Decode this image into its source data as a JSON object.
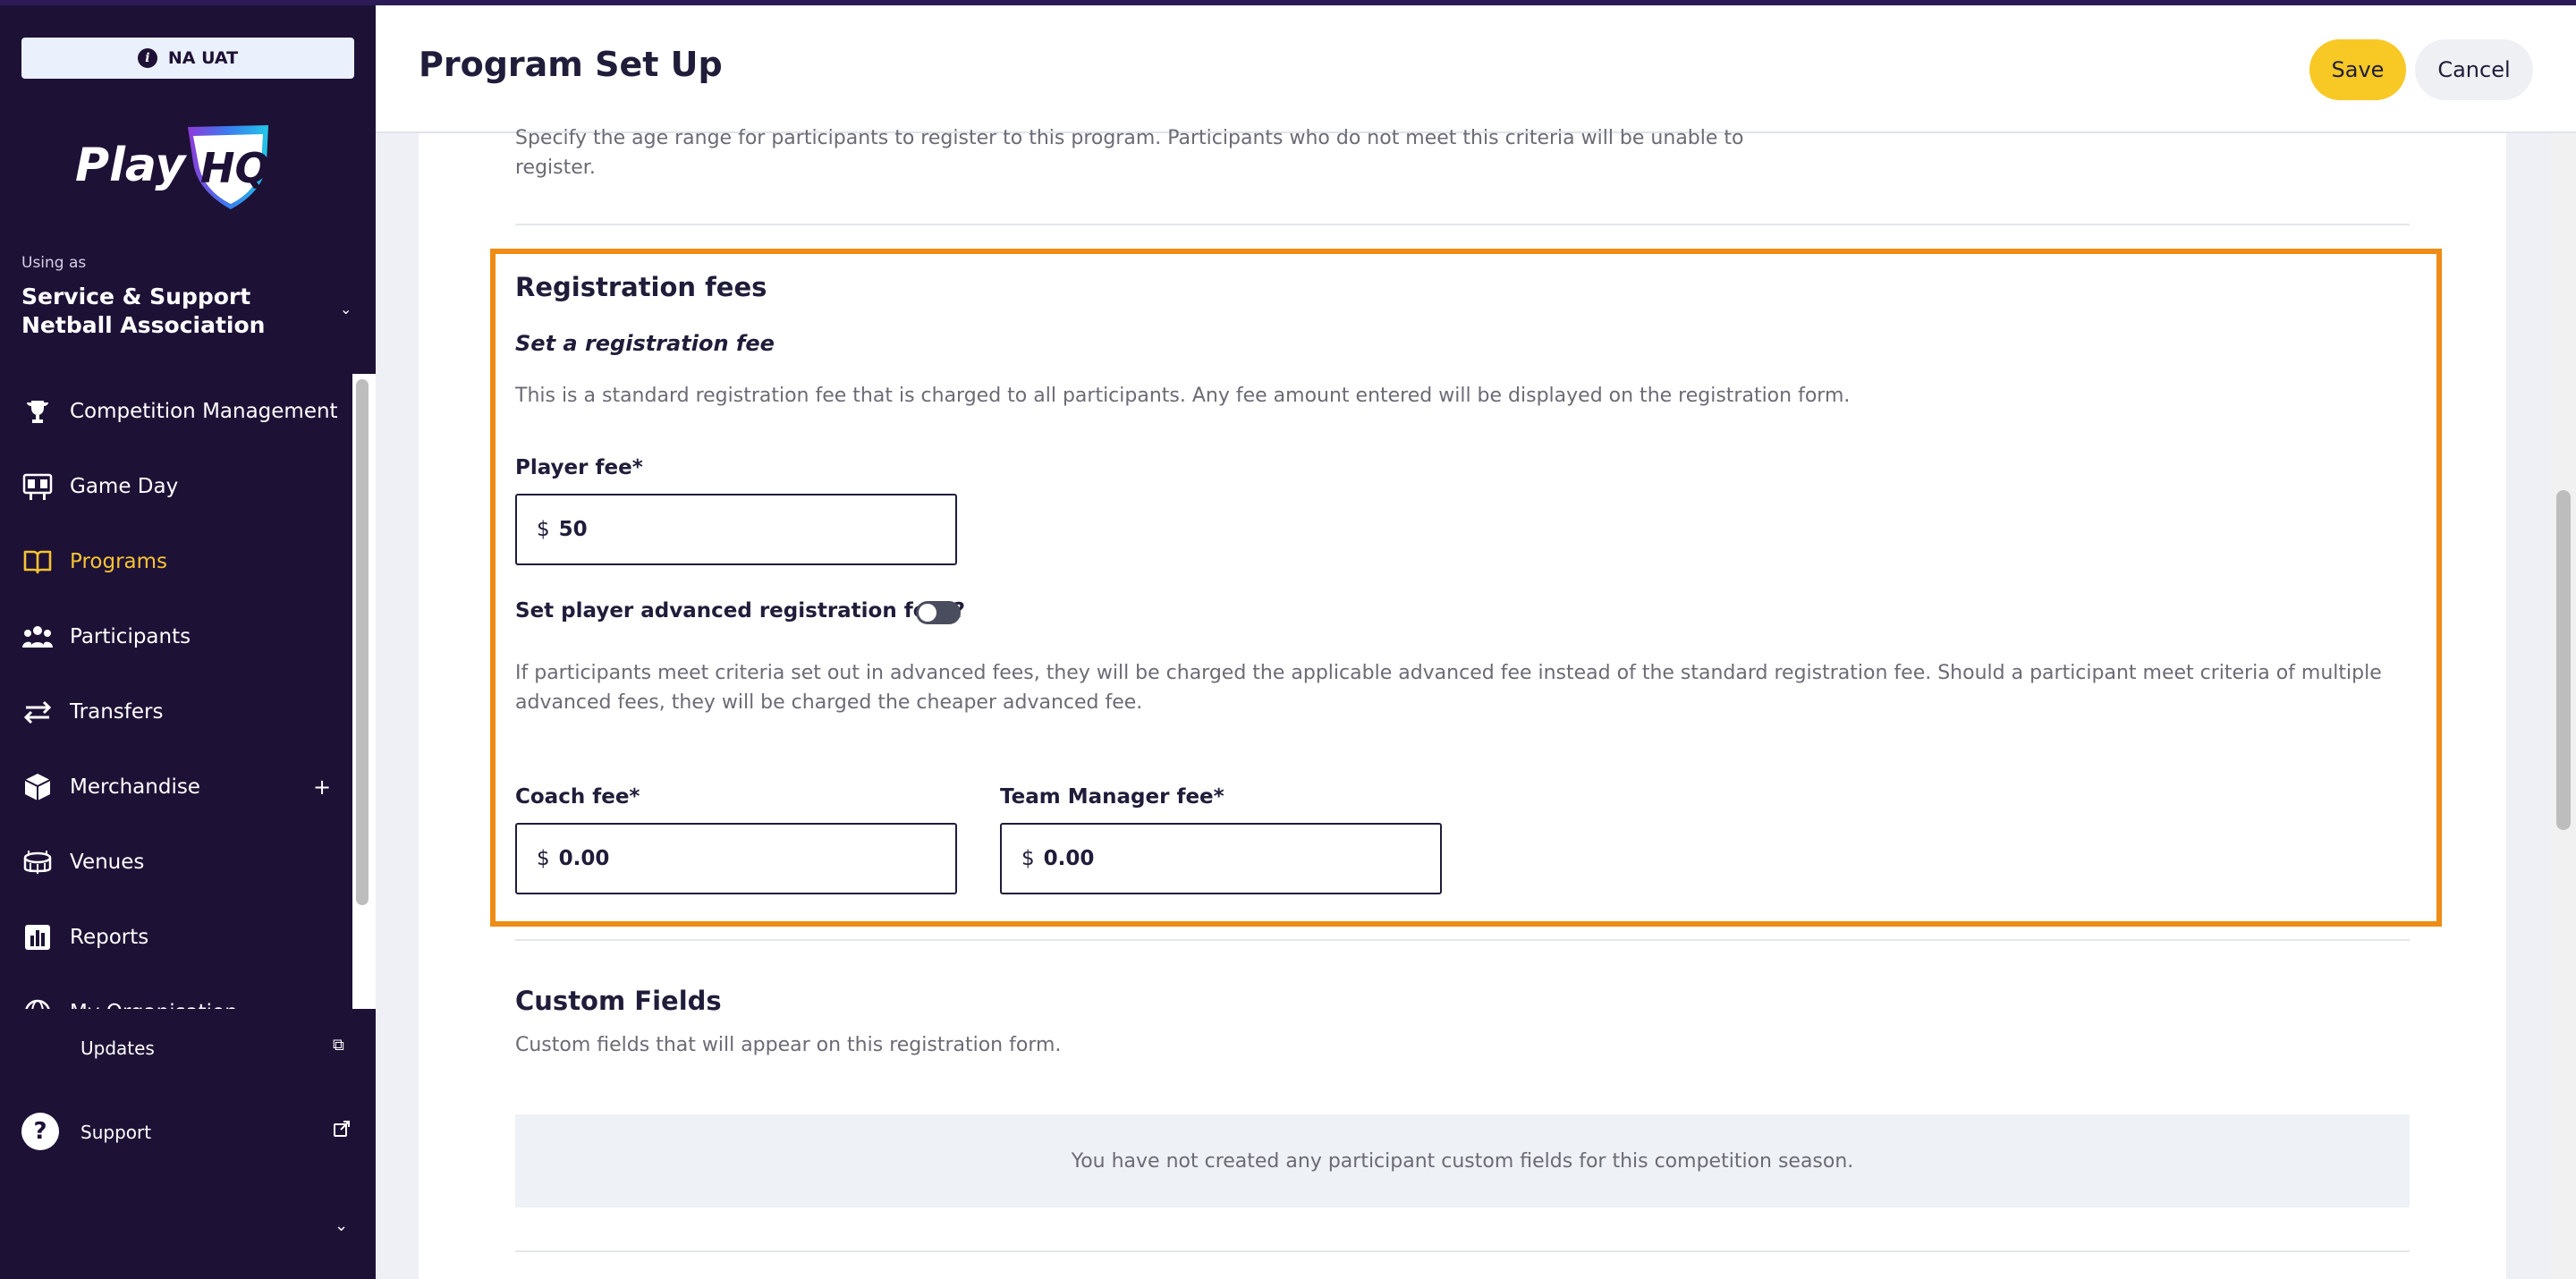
{
  "env": {
    "label": "NA UAT"
  },
  "brand": {
    "logo_text": "PlayHQ"
  },
  "account": {
    "using_as": "Using as",
    "org": "Service & Support Netball Association"
  },
  "sidebar": {
    "items": [
      {
        "label": "Competition Management",
        "icon": "trophy-icon"
      },
      {
        "label": "Game Day",
        "icon": "scoreboard-icon"
      },
      {
        "label": "Programs",
        "icon": "book-icon",
        "active": true
      },
      {
        "label": "Participants",
        "icon": "people-icon"
      },
      {
        "label": "Transfers",
        "icon": "transfer-arrows-icon"
      },
      {
        "label": "Merchandise",
        "icon": "box-icon"
      },
      {
        "label": "Venues",
        "icon": "stadium-icon"
      },
      {
        "label": "Reports",
        "icon": "bar-chart-icon"
      },
      {
        "label": "My Organisation",
        "icon": "globe-icon"
      }
    ],
    "updates": "Updates",
    "support": "Support"
  },
  "header": {
    "title": "Program Set Up",
    "save": "Save",
    "cancel": "Cancel"
  },
  "age": {
    "description": "Specify the age range for participants to register to this program. Participants who do not meet this criteria will be unable to register."
  },
  "fees": {
    "title": "Registration fees",
    "subtitle": "Set a registration fee",
    "description": "This is a standard registration fee that is charged to all participants. Any fee amount entered will be displayed on the registration form.",
    "player_label": "Player fee*",
    "currency": "$",
    "player_value": "50",
    "advanced_label": "Set player advanced registration fees?",
    "advanced_enabled": false,
    "advanced_description": "If participants meet criteria set out in advanced fees, they will be charged the applicable advanced fee instead of the standard registration fee. Should a participant meet criteria of multiple advanced fees, they will be charged the cheaper advanced fee.",
    "coach_label": "Coach fee*",
    "coach_value": "0.00",
    "manager_label": "Team Manager fee*",
    "manager_value": "0.00"
  },
  "custom_fields": {
    "title": "Custom Fields",
    "description": "Custom fields that will appear on this registration form.",
    "empty": "You have not created any participant custom fields for this competition season."
  },
  "colors": {
    "sidebar": "#1e1136",
    "accent": "#f5c432",
    "highlight": "#ee8c16",
    "save": "#f8c825"
  }
}
